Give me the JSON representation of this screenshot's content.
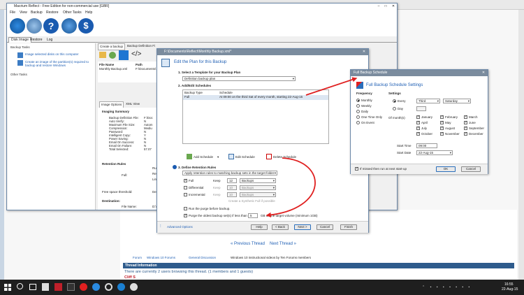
{
  "browser": {
    "forum_links": [
      "Forum",
      "Windows 10 Forums",
      "General Discussion",
      "Windows 10 instructional videos by Ten Forums members"
    ],
    "prev_thread": "« Previous Thread",
    "next_thread": "Next Thread »",
    "thread_information": "Thread Information",
    "browsing_text": "There are currently 2 users browsing this thread. (1 members and 1 guests)",
    "member": "Cliff S"
  },
  "app": {
    "title": "Macrium Reflect - Free Edition for non-commercial use [GBR]",
    "menu": [
      "File",
      "View",
      "Backup",
      "Restore",
      "Other Tasks",
      "Help"
    ],
    "tabs": [
      "Disk Image",
      "Restore",
      "Log"
    ],
    "backup_tasks_header": "Backup Tasks",
    "task_1": "Image selected disks on this computer",
    "task_2": "Create an image of the partition(s) required to backup and restore Windows",
    "other_tasks_header": "Other Tasks",
    "right_tabs": [
      "Create a backup",
      "Backup Definition Fi"
    ],
    "file_col_name": "File Name",
    "file_col_path": "Path",
    "file_name": "Monthly Backup.xml",
    "file_path": "F:\\Documents\\",
    "sub_tabs": [
      "Image Options",
      "XML View"
    ],
    "imaging_summary_title": "Imaging Summary",
    "summary_labels": [
      "Backup Definition File:",
      "Auto Verify:",
      "Maximum File Size:",
      "Compression:",
      "Password:",
      "Intelligent Copy:",
      "Power Saving:",
      "Email On Success:",
      "Email On Failure:",
      "Total Selected:"
    ],
    "summary_values": [
      "F:\\Doc",
      "N",
      "Autom",
      "Mediu",
      "N",
      "Y",
      "N",
      "N",
      "N",
      "57.07"
    ],
    "retention_rules_title": "Retention Rules",
    "full_label": "Full:",
    "rules_snippets": [
      "Rules",
      "Retai",
      "Linked"
    ],
    "free_space_label": "Free space threshold:",
    "free_space_value": "Delete",
    "destination_title": "Destination:",
    "dest_file_name_label": "File Name:",
    "dest_file_name_value": "D:\\MM"
  },
  "wizard": {
    "title": "F:\\Documents\\Reflect\\Monthly Backup.xml*",
    "header": "Edit the Plan for this Backup",
    "step1": "1. Select a Template for your Backup Plan",
    "template_value": "Definition backup plan",
    "step2": "2. Add/Edit Schedules",
    "col_type": "Backup Type",
    "col_schedule": "Schedule",
    "row_type": "Full",
    "row_schedule": "At 09:00 on the third Sat of every month, starting 22-Aug-15",
    "add_schedule": "Add Schedule",
    "edit_schedule": "Edit Schedule",
    "delete_schedule": "Delete Schedule",
    "step3": "3. Define Retention Rules",
    "retention_select": "Apply retention rules to matching backup sets in the target folder",
    "row_labels": [
      "Full",
      "Differential",
      "Incremental"
    ],
    "keep_label": "Keep",
    "keep_values": [
      "12",
      "10",
      "10"
    ],
    "unit_value": "Backups",
    "synthetic_label": "Create a Synthetic Full if possible",
    "purge_before": "Run the purge before backup.",
    "purge_oldest": "Purge the oldest backup set(s) if less than",
    "purge_value": "5",
    "purge_suffix": "GB on the target volume (minimum 1GB)",
    "advanced": "Advanced Options",
    "buttons": [
      "Help",
      "< Back",
      "Next >",
      "Cancel",
      "Finish"
    ]
  },
  "schedule": {
    "title": "Full Backup Schedule",
    "heading": "Full Backup Schedule Settings",
    "frequency_label": "Frequency",
    "settings_label": "Settings",
    "frequencies": [
      "Monthly",
      "Weekly",
      "Daily",
      "One Time Only",
      "On Event"
    ],
    "every_label": "Every",
    "day_label": "Day",
    "week_value": "Third",
    "day_value": "Saturday",
    "of_months_label": "Of month(s)",
    "months": [
      "January",
      "February",
      "March",
      "April",
      "May",
      "June",
      "July",
      "August",
      "September",
      "October",
      "November",
      "December"
    ],
    "start_time_label": "Start Time",
    "start_time_value": "09:00",
    "start_date_label": "Start Date",
    "start_date_value": "22-Aug-15",
    "missed_label": "If missed then run at next start-up",
    "ok": "OK",
    "cancel": "Cancel"
  },
  "taskbar": {
    "time": "16:55",
    "date": "22-Aug-15"
  },
  "colors": {
    "accent_red": "#e02020",
    "title_blue": "#1f5fb4"
  }
}
